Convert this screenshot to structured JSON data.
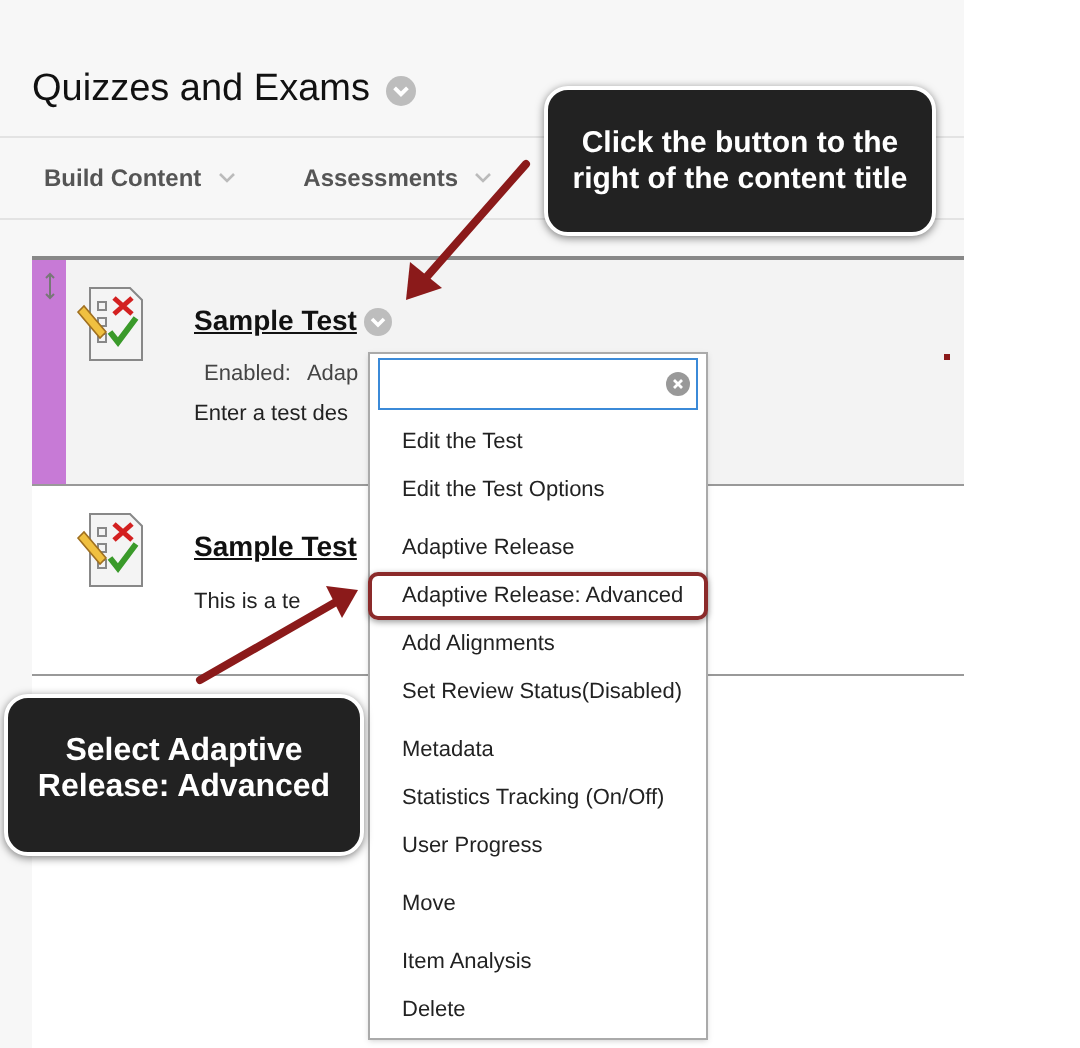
{
  "page": {
    "title": "Quizzes and Exams"
  },
  "toolbar": [
    {
      "label": "Build Content"
    },
    {
      "label": "Assessments"
    }
  ],
  "items": [
    {
      "title": "Sample Test",
      "selected": true,
      "status_label": "Enabled:",
      "status_value": "Adap",
      "description": "Enter a test des"
    },
    {
      "title": "Sample Test",
      "selected": false,
      "description": "This is a te"
    }
  ],
  "menu": {
    "groups": [
      [
        {
          "label": "Edit the Test",
          "selected": false
        },
        {
          "label": "Edit the Test Options",
          "selected": false
        }
      ],
      [
        {
          "label": "Adaptive Release",
          "selected": false
        },
        {
          "label": "Adaptive Release: Advanced",
          "selected": true
        },
        {
          "label": "Add Alignments",
          "selected": false
        },
        {
          "label": "Set Review Status(Disabled)",
          "selected": false
        }
      ],
      [
        {
          "label": "Metadata",
          "selected": false
        },
        {
          "label": "Statistics Tracking (On/Off)",
          "selected": false
        },
        {
          "label": "User Progress",
          "selected": false
        }
      ],
      [
        {
          "label": "Move",
          "selected": false
        }
      ],
      [
        {
          "label": "Item Analysis",
          "selected": false
        },
        {
          "label": "Delete",
          "selected": false
        }
      ]
    ]
  },
  "callouts": [
    {
      "text": "Click the button to the right of the content title"
    },
    {
      "text": "Select Adaptive Release: Advanced"
    }
  ]
}
